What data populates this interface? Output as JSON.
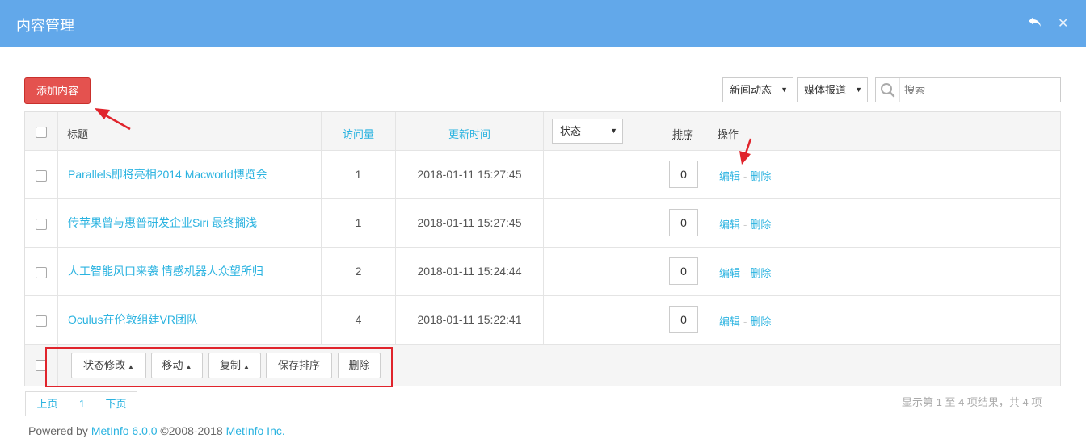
{
  "window": {
    "title": "内容管理",
    "back_icon": "undo-arrow-icon",
    "close_icon": "close-icon"
  },
  "toolbar": {
    "add_label": "添加内容",
    "category_select": "新闻动态",
    "subcategory_select": "媒体报道",
    "search_placeholder": "搜索"
  },
  "table": {
    "headers": {
      "title": "标题",
      "visits": "访问量",
      "updated": "更新时间",
      "status": "状态",
      "sort": "排序",
      "actions": "操作"
    },
    "rows": [
      {
        "title": "Parallels即将亮相2014 Macworld博览会",
        "visits": "1",
        "updated": "2018-01-11 15:27:45",
        "sort": "0",
        "edit": "编辑",
        "delete": "删除"
      },
      {
        "title": "传苹果曾与惠普研发企业Siri 最终搁浅",
        "visits": "1",
        "updated": "2018-01-11 15:27:45",
        "sort": "0",
        "edit": "编辑",
        "delete": "删除"
      },
      {
        "title": "人工智能风口来袭 情感机器人众望所归",
        "visits": "2",
        "updated": "2018-01-11 15:24:44",
        "sort": "0",
        "edit": "编辑",
        "delete": "删除"
      },
      {
        "title": "Oculus在伦敦组建VR团队",
        "visits": "4",
        "updated": "2018-01-11 15:22:41",
        "sort": "0",
        "edit": "编辑",
        "delete": "删除"
      }
    ],
    "separator": "-",
    "bulk_actions": {
      "status_change": "状态修改",
      "move": "移动",
      "copy": "复制",
      "save_sort": "保存排序",
      "delete": "删除"
    }
  },
  "pagination": {
    "prev": "上页",
    "current": "1",
    "next": "下页"
  },
  "summary": "显示第 1 至 4 项结果，共 4 项",
  "footer": {
    "powered": "Powered by ",
    "product": "MetInfo 6.0.0",
    "copyright": " ©2008-2018 ",
    "company": "MetInfo Inc."
  },
  "colors": {
    "header_bg": "#62a8ea",
    "add_button": "#e4524f",
    "link": "#2bb3e0",
    "annotation": "#e0242c"
  }
}
